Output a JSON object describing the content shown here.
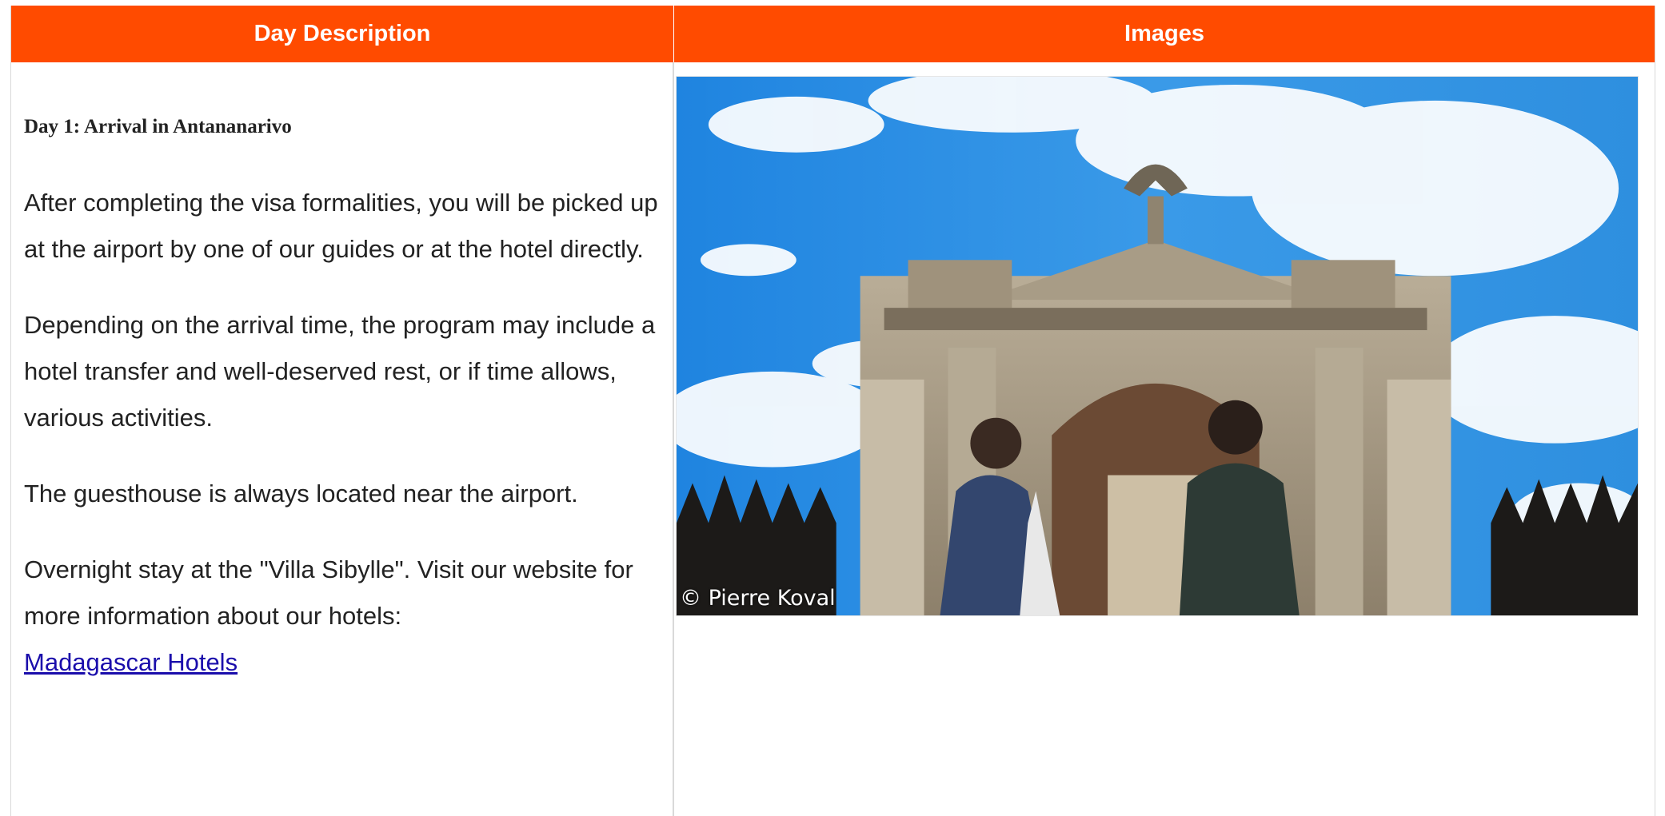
{
  "table": {
    "headers": {
      "description": "Day Description",
      "images": "Images"
    }
  },
  "day": {
    "title": "Day 1: Arrival in Antananarivo",
    "paragraphs": [
      "After completing the visa formalities, you will be picked up at the airport by one of our guides or at the hotel directly.",
      "Depending on the arrival time, the program may include a hotel transfer and well-deserved rest, or if time allows, various activities.",
      "The guesthouse is always located near the airport."
    ],
    "overnight_text": "Overnight stay at the \"Villa Sibylle\". Visit our website for more information about our hotels:",
    "link_text": "Madagascar Hotels"
  },
  "image": {
    "credit": "© Pierre Koval"
  },
  "colors": {
    "header_bg": "#ff4b00",
    "header_text": "#ffffff",
    "link": "#1a0dab",
    "border": "#d9d9d9"
  }
}
